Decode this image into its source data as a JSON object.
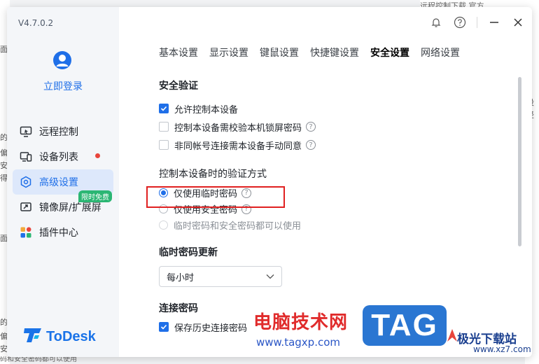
{
  "background": {
    "left_fragments": [
      "面",
      "的",
      "偏",
      "安",
      "得",
      "面",
      "的",
      "偏",
      "安"
    ],
    "right_fragments": [
      "设",
      "轻"
    ],
    "top_fragment": "远程控制下载   官方",
    "bottom_fragment": "码和安全密码都可以使用"
  },
  "sidebar": {
    "version": "V4.7.0.2",
    "login_label": "立即登录",
    "items": [
      {
        "label": "远程控制",
        "icon": "remote-control-icon"
      },
      {
        "label": "设备列表",
        "icon": "device-list-icon"
      },
      {
        "label": "高级设置",
        "icon": "advanced-settings-icon"
      },
      {
        "label": "镜像屏/扩展屏",
        "icon": "mirror-screen-icon",
        "badge": "限时免费"
      },
      {
        "label": "插件中心",
        "icon": "plugin-center-icon"
      }
    ],
    "brand": "ToDesk"
  },
  "tabs": [
    "基本设置",
    "显示设置",
    "键鼠设置",
    "快捷键设置",
    "安全设置",
    "网络设置"
  ],
  "active_tab": "安全设置",
  "security": {
    "title": "安全验证",
    "options": [
      {
        "label": "允许控制本设备",
        "checked": true
      },
      {
        "label": "控制本设备需校验本机锁屏密码",
        "checked": false,
        "help": "?"
      },
      {
        "label": "非同帐号连接需本设备手动同意",
        "checked": false,
        "help": "?"
      }
    ]
  },
  "verify": {
    "title": "控制本设备时的验证方式",
    "options": [
      {
        "label": "仅使用临时密码",
        "selected": true,
        "help": "?"
      },
      {
        "label": "仅使用安全密码",
        "selected": false,
        "help": "?"
      },
      {
        "label": "临时密码和安全密码都可以使用",
        "selected": false
      }
    ]
  },
  "temp_password": {
    "title": "临时密码更新",
    "value": "每小时"
  },
  "connection_password": {
    "title": "连接密码",
    "option": "保存历史连接密码"
  },
  "watermark": {
    "title": "电脑技术网",
    "url": "www.tagxp.com",
    "tag": "TAG",
    "site": "极光下载站",
    "site_url": "www.xz7.com"
  },
  "colors": {
    "accent": "#1f6fe8",
    "highlight_box": "#e02020",
    "badge": "#2bb673"
  }
}
